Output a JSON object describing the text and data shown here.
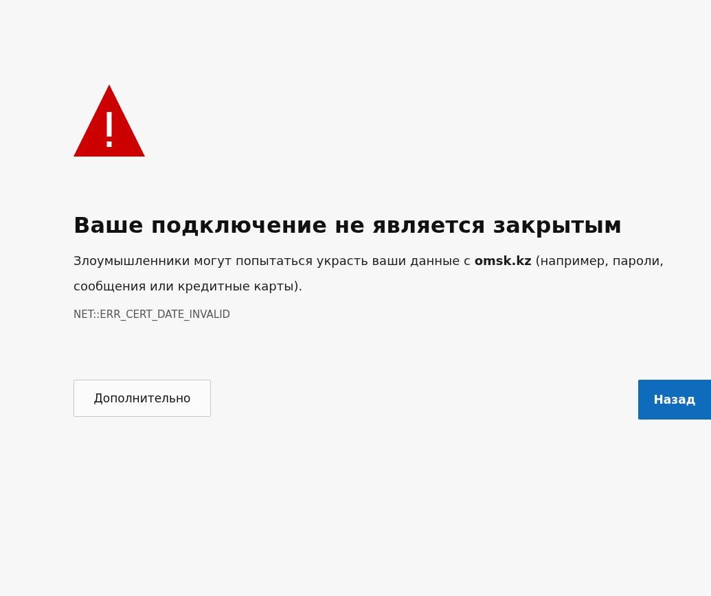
{
  "heading": "Ваше подключение не является закрытым",
  "message": "Злоумышленники могут попытаться украсть ваши данные с **omsk.kz** (например, пароли, сообщения или кредитные карты).",
  "error_code": "NET::ERR_CERT_DATE_INVALID",
  "buttons": [
    {
      "label": "Дополнительно",
      "kind": "secondary"
    },
    {
      "label": "Назад",
      "kind": "primary"
    }
  ]
}
